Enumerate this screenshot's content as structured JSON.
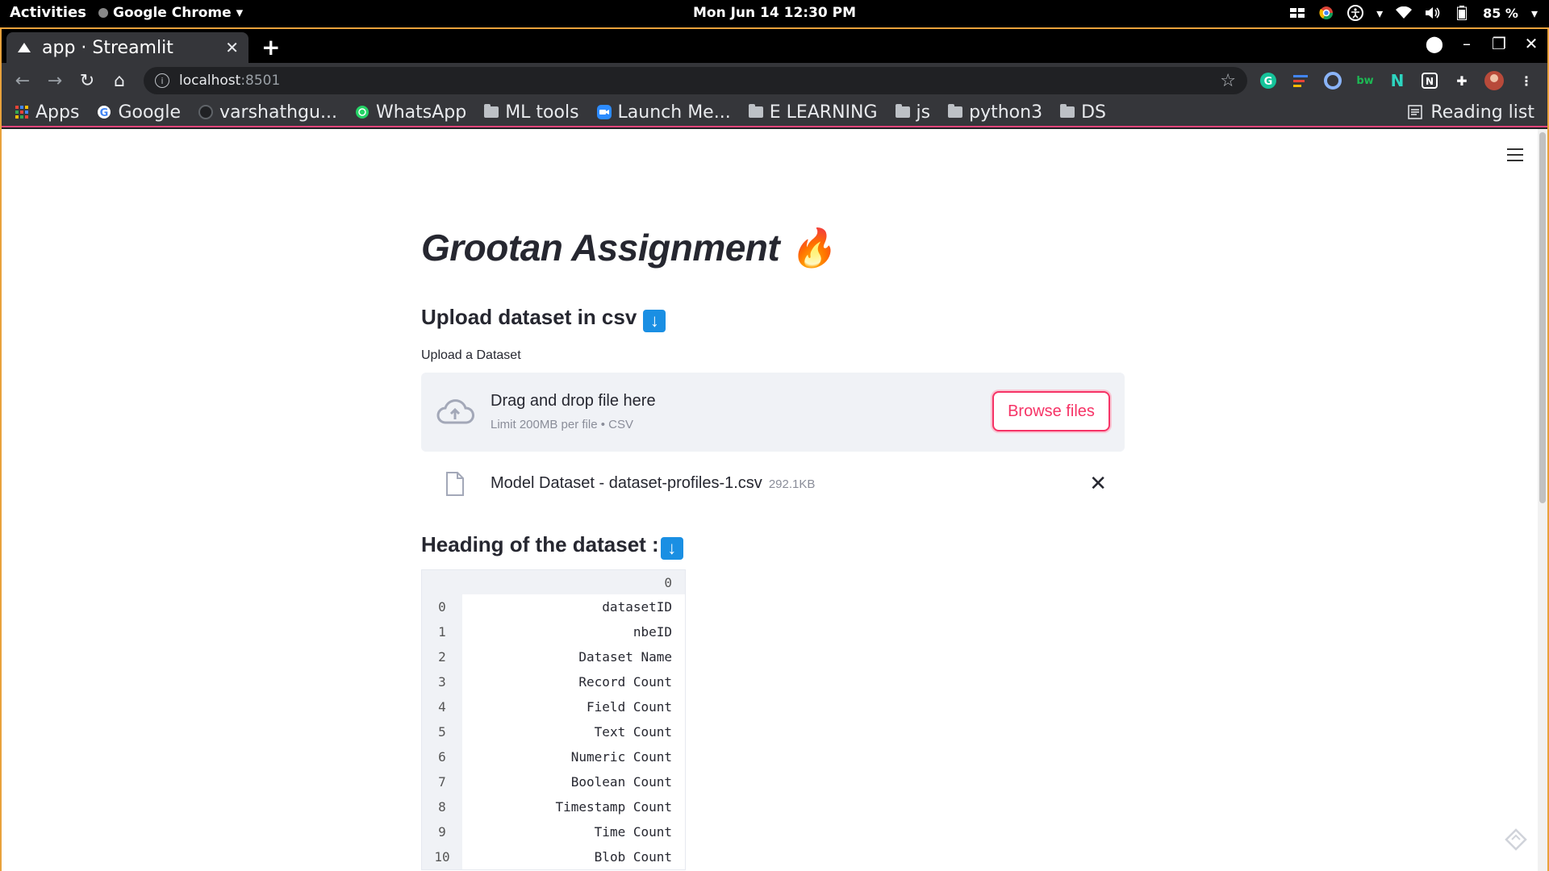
{
  "topbar": {
    "activities": "Activities",
    "app": "Google Chrome",
    "clock": "Mon Jun 14  12:30 PM",
    "battery": "85 %"
  },
  "browser": {
    "tab_title": "app · Streamlit",
    "url_host": "localhost",
    "url_port": ":8501"
  },
  "bookmarks": [
    {
      "label": "Apps",
      "icon": "apps-grid-icon"
    },
    {
      "label": "Google",
      "icon": "google-icon"
    },
    {
      "label": "varshathgu...",
      "icon": "github-icon"
    },
    {
      "label": "WhatsApp",
      "icon": "whatsapp-icon"
    },
    {
      "label": "ML tools",
      "icon": "folder-icon"
    },
    {
      "label": "Launch Me...",
      "icon": "zoom-icon"
    },
    {
      "label": "E LEARNING",
      "icon": "folder-icon"
    },
    {
      "label": "js",
      "icon": "folder-icon"
    },
    {
      "label": "python3",
      "icon": "folder-icon"
    },
    {
      "label": "DS",
      "icon": "folder-icon"
    }
  ],
  "reading_list": "Reading list",
  "app": {
    "title": "Grootan Assignment 🔥",
    "upload_heading": "Upload dataset in csv",
    "upload_label": "Upload a Dataset",
    "dropzone_text": "Drag and drop file here",
    "dropzone_limit": "Limit 200MB per file • CSV",
    "browse_label": "Browse files",
    "file_name": "Model Dataset - dataset-profiles-1.csv",
    "file_size": "292.1KB",
    "heading_dataset": "Heading of the dataset :",
    "accent": "#f63366"
  },
  "dataframe": {
    "column": "0",
    "rows": [
      {
        "index": "0",
        "value": "datasetID"
      },
      {
        "index": "1",
        "value": "nbeID"
      },
      {
        "index": "2",
        "value": "Dataset Name"
      },
      {
        "index": "3",
        "value": "Record Count"
      },
      {
        "index": "4",
        "value": "Field Count"
      },
      {
        "index": "5",
        "value": "Text Count"
      },
      {
        "index": "6",
        "value": "Numeric Count"
      },
      {
        "index": "7",
        "value": "Boolean Count"
      },
      {
        "index": "8",
        "value": "Timestamp Count"
      },
      {
        "index": "9",
        "value": "Time Count"
      },
      {
        "index": "10",
        "value": "Blob Count"
      }
    ]
  }
}
